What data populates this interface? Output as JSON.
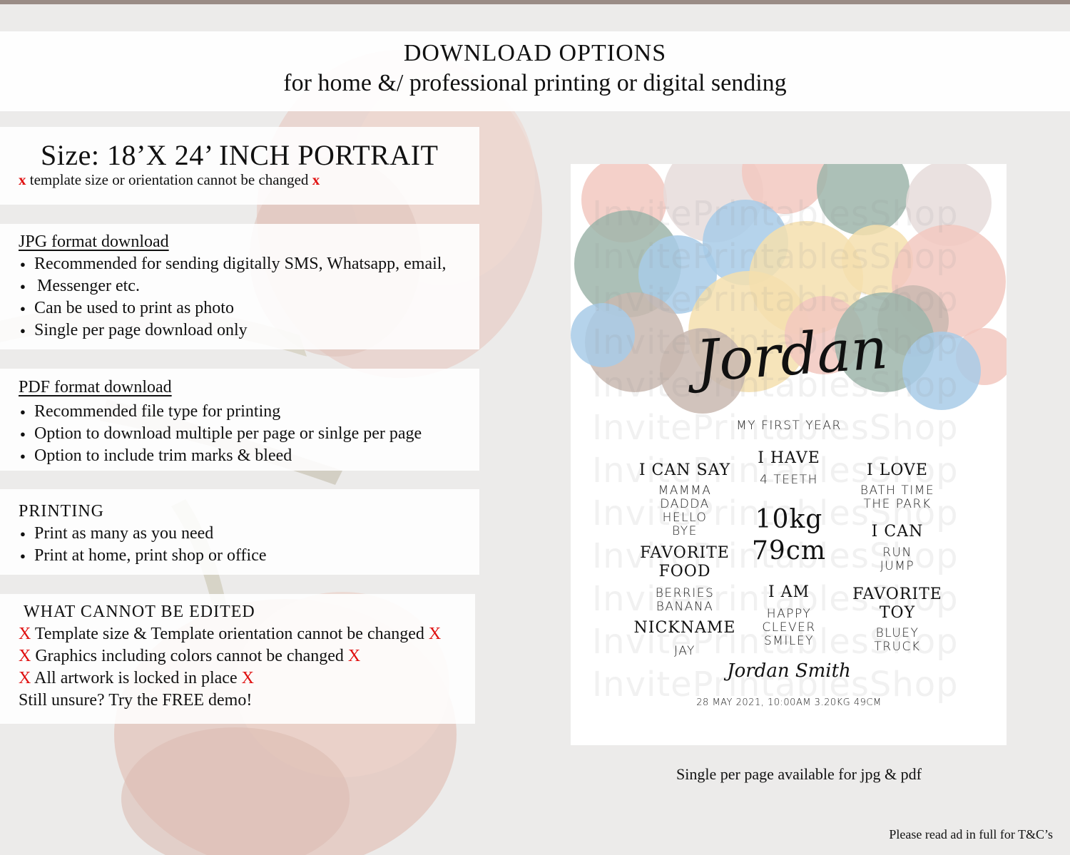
{
  "header": {
    "title": "DOWNLOAD OPTIONS",
    "subtitle": "for home &/ professional printing or digital sending"
  },
  "size_panel": {
    "title": "Size: 18’X 24’ INCH PORTRAIT",
    "mark": "x",
    "note": "template size or orientation cannot be changed"
  },
  "jpg": {
    "title": "JPG format download",
    "items": [
      "Recommended for sending digitally SMS, Whatsapp, email,",
      "Messenger etc.",
      "Can be used to print as photo",
      "Single per page download only"
    ]
  },
  "pdf": {
    "title": "PDF format download",
    "items": [
      "Recommended file type for printing",
      "Option to download multiple per page or sinlge per page",
      "Option to include trim marks & bleed"
    ]
  },
  "printing": {
    "title": "PRINTING",
    "items": [
      "Print as many as you need",
      "Print at home, print shop or office"
    ]
  },
  "cannot_edit": {
    "title": "WHAT CANNOT BE EDITED",
    "mark": "X",
    "lines": [
      "Template size & Template orientation cannot be changed",
      "Graphics including colors cannot be changed",
      "All artwork is locked in place"
    ],
    "closing": "Still unsure? Try the FREE demo!"
  },
  "poster": {
    "watermark": "InvitePrintablesShop",
    "name": "Jordan",
    "subtitle": "MY FIRST YEAR",
    "i_have": {
      "title": "I HAVE",
      "value": "4 TEETH"
    },
    "i_can_say": {
      "title": "I CAN SAY",
      "items": [
        "MAMMA",
        "DADDA",
        "HELLO",
        "BYE"
      ]
    },
    "i_love": {
      "title": "I LOVE",
      "items": [
        "BATH TIME",
        "THE PARK"
      ]
    },
    "weight": "10kg",
    "height": "79cm",
    "i_can": {
      "title": "I CAN",
      "items": [
        "RUN",
        "JUMP"
      ]
    },
    "favorite_food": {
      "title_1": "FAVORITE",
      "title_2": "FOOD",
      "items": [
        "BERRIES",
        "BANANA"
      ]
    },
    "i_am": {
      "title": "I AM",
      "items": [
        "HAPPY",
        "CLEVER",
        "SMILEY"
      ]
    },
    "favorite_toy": {
      "title_1": "FAVORITE",
      "title_2": "TOY",
      "items": [
        "BLUEY",
        "TRUCK"
      ]
    },
    "nickname": {
      "title": "NICKNAME",
      "value": "JAY"
    },
    "full_name": "Jordan Smith",
    "birth_details": "28 MAY 2021, 10:00AM 3.20KG 49CM",
    "bubble_colors": [
      "#f2c8bf",
      "#9eb5aa",
      "#a8cbe8",
      "#f5dfae",
      "#c9b8b0",
      "#e6dcda"
    ]
  },
  "caption": "Single per page available for jpg & pdf",
  "footnote": "Please read ad in full for T&C’s"
}
